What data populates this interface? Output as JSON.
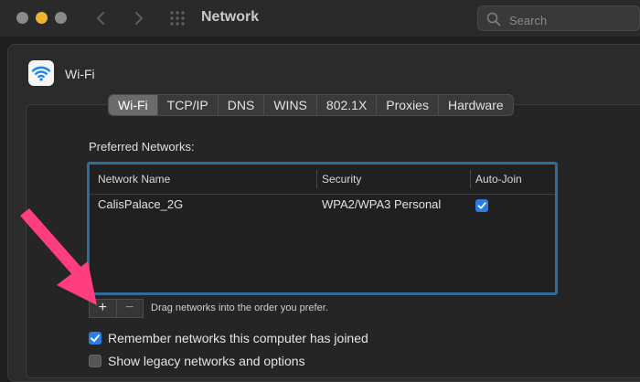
{
  "window": {
    "title": "Network",
    "search_placeholder": "Search"
  },
  "interface": {
    "name": "Wi-Fi"
  },
  "tabs": [
    {
      "label": "Wi-Fi",
      "active": true
    },
    {
      "label": "TCP/IP",
      "active": false
    },
    {
      "label": "DNS",
      "active": false
    },
    {
      "label": "WINS",
      "active": false
    },
    {
      "label": "802.1X",
      "active": false
    },
    {
      "label": "Proxies",
      "active": false
    },
    {
      "label": "Hardware",
      "active": false
    }
  ],
  "preferred": {
    "label": "Preferred Networks:",
    "columns": [
      "Network Name",
      "Security",
      "Auto-Join"
    ],
    "rows": [
      {
        "name": "CalisPalace_2G",
        "security": "WPA2/WPA3 Personal",
        "auto_join": true
      }
    ]
  },
  "controls": {
    "add_label": "+",
    "remove_label": "−",
    "drag_hint": "Drag networks into the order you prefer."
  },
  "options": {
    "remember": {
      "label": "Remember networks this computer has joined",
      "checked": true
    },
    "legacy": {
      "label": "Show legacy networks and options",
      "checked": false
    }
  },
  "colors": {
    "accent": "#2b7de3",
    "annotation_arrow": "#ff3d7f",
    "table_focus": "#2e6c9c"
  }
}
